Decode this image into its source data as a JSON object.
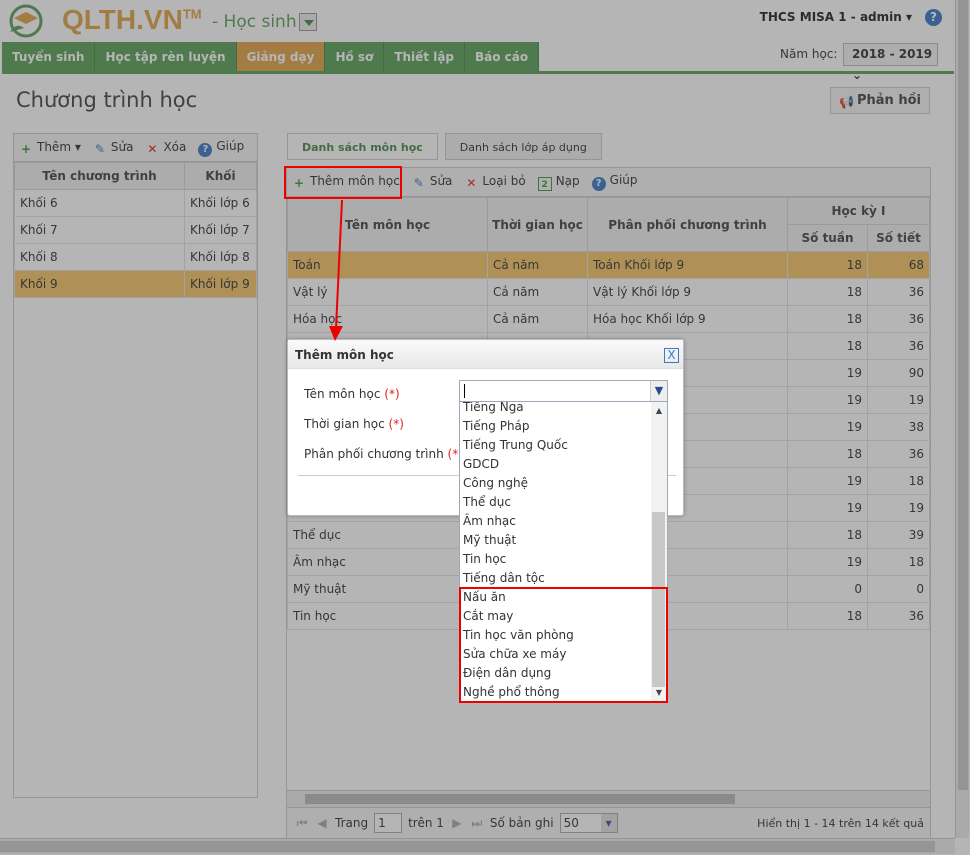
{
  "header": {
    "brand": "QLTH.VN",
    "brand_tm": "TM",
    "module": "- Học sinh",
    "user": "THCS MISA 1 - admin ▾",
    "help_icon": "?"
  },
  "nav": {
    "tabs": [
      "Tuyển sinh",
      "Học tập rèn luyện",
      "Giảng dạy",
      "Hồ sơ",
      "Thiết lập",
      "Báo cáo"
    ],
    "active": "Giảng dạy"
  },
  "year": {
    "label": "Năm học:",
    "value": "2018 - 2019 ⌄"
  },
  "page": {
    "title": "Chương trình học",
    "feedback": "Phản hồi"
  },
  "left": {
    "toolbar": {
      "add": "Thêm ▾",
      "edit": "Sửa",
      "delete": "Xóa",
      "help": "Giúp"
    },
    "columns": [
      "Tên chương trình",
      "Khối"
    ],
    "rows": [
      [
        "Khối 6",
        "Khối lớp 6"
      ],
      [
        "Khối 7",
        "Khối lớp 7"
      ],
      [
        "Khối 8",
        "Khối lớp 8"
      ],
      [
        "Khối 9",
        "Khối lớp 9"
      ]
    ],
    "selected": 3
  },
  "right": {
    "tabs": [
      "Danh sách môn học",
      "Danh sách lớp áp dụng"
    ],
    "toolbar": {
      "add": "Thêm môn học",
      "edit": "Sửa",
      "remove": "Loại bỏ",
      "load": "Nạp",
      "help": "Giúp"
    },
    "columns": {
      "name": "Tên môn học",
      "time": "Thời gian học",
      "ppct": "Phân phối chương trình",
      "hk1": "Học kỳ I",
      "weeks": "Số tuần",
      "periods": "Số tiết"
    },
    "rows": [
      [
        "Toán",
        "Cả năm",
        "Toán Khối lớp 9",
        "18",
        "68"
      ],
      [
        "Vật lý",
        "Cả năm",
        "Vật lý Khối lớp 9",
        "18",
        "36"
      ],
      [
        "Hóa học",
        "Cả năm",
        "Hóa học Khối lớp 9",
        "18",
        "36"
      ],
      [
        "",
        "",
        "",
        "18",
        "36"
      ],
      [
        "",
        "",
        "",
        "19",
        "90"
      ],
      [
        "",
        "",
        "",
        "19",
        "19"
      ],
      [
        "",
        "",
        "",
        "19",
        "38"
      ],
      [
        "",
        "",
        "",
        "18",
        "36"
      ],
      [
        "",
        "",
        "",
        "19",
        "18"
      ],
      [
        "",
        "",
        "",
        "19",
        "19"
      ],
      [
        "Thể dục",
        "",
        "",
        "18",
        "39"
      ],
      [
        "Âm nhạc",
        "",
        "",
        "19",
        "18"
      ],
      [
        "Mỹ thuật",
        "",
        "",
        "0",
        "0"
      ],
      [
        "Tin học",
        "",
        "",
        "18",
        "36"
      ]
    ],
    "pager": {
      "page_label": "Trang",
      "page": "1",
      "of": "trên 1",
      "size_label": "Số bản ghi",
      "size": "50",
      "info": "Hiển thị 1 - 14 trên 14 kết quả"
    }
  },
  "dialog": {
    "title": "Thêm môn học",
    "close": "X",
    "fields": [
      "Tên môn học",
      "Thời gian học",
      "Phân phối chương trình"
    ],
    "required": "(*)",
    "options": [
      "Tiếng Nga",
      "Tiếng Pháp",
      "Tiếng Trung Quốc",
      "GDCD",
      "Công nghệ",
      "Thể dục",
      "Âm nhạc",
      "Mỹ thuật",
      "Tin học",
      "Tiếng dân tộc",
      "Nấu ăn",
      "Cắt may",
      "Tin học văn phòng",
      "Sửa chữa xe máy",
      "Điện dân dụng",
      "Nghề phổ thông"
    ]
  },
  "colors": {
    "green": "#5aa05a",
    "orange": "#e2a34a",
    "highlight": "#e00000"
  }
}
